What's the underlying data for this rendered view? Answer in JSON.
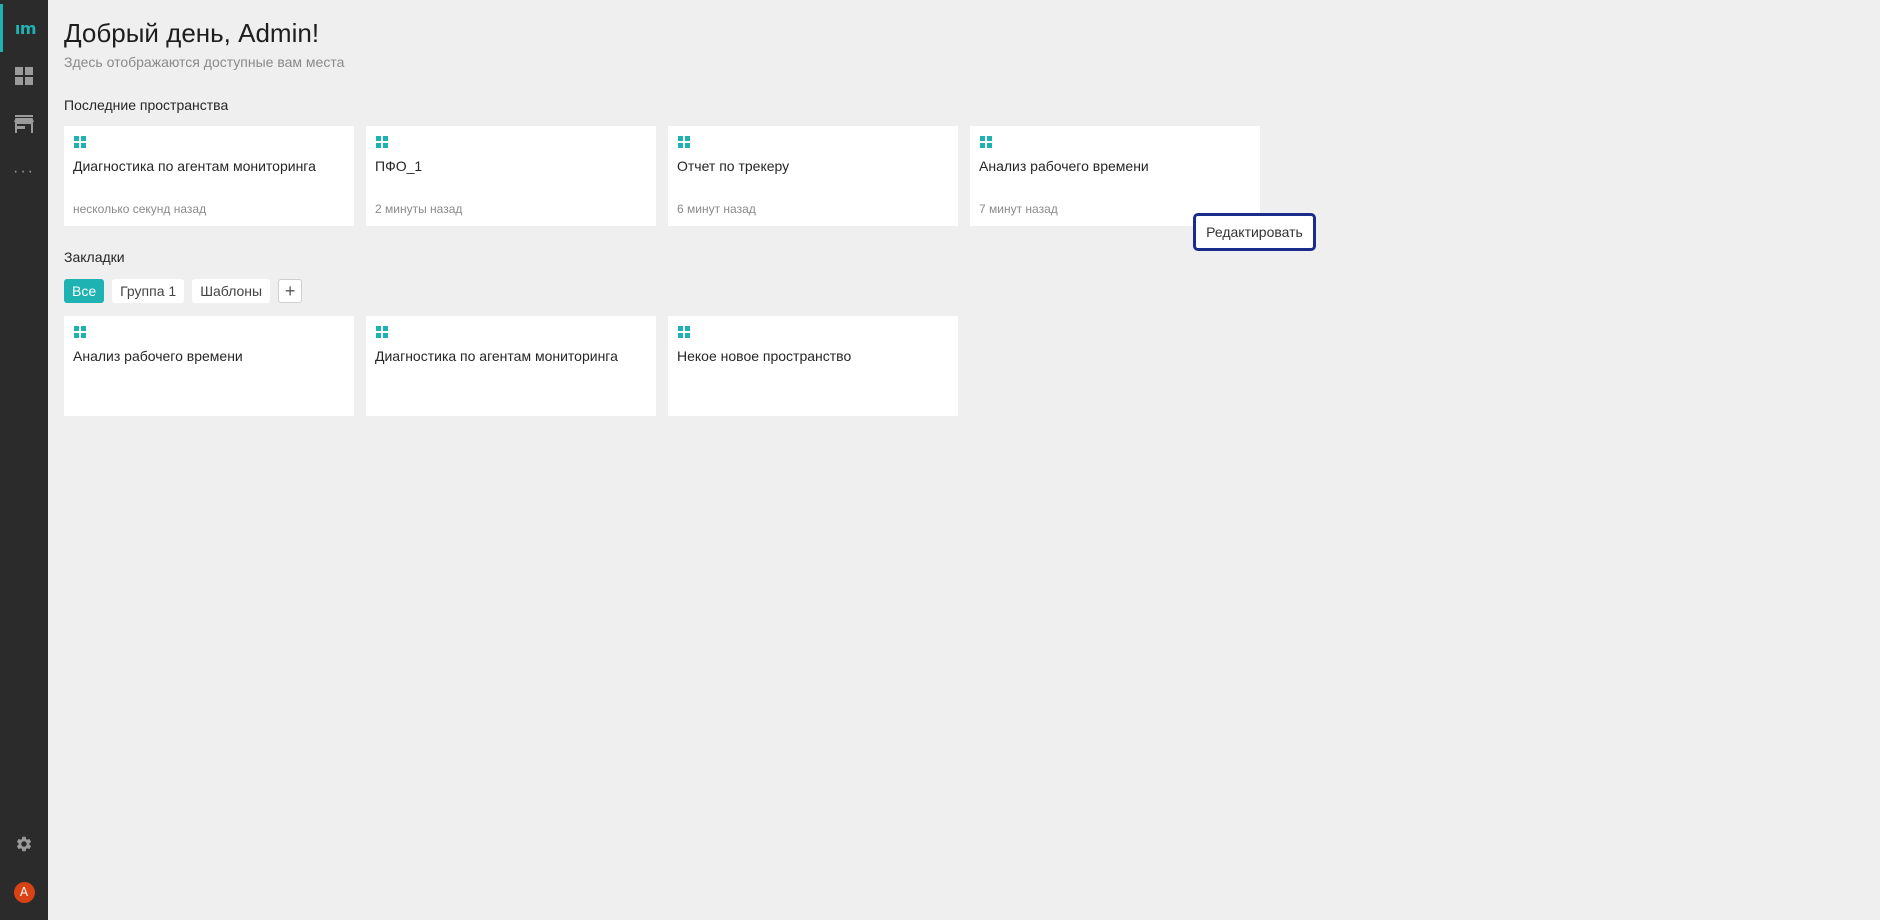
{
  "sidebar": {
    "logo": "ım",
    "items": [
      {
        "icon": "dashboard-grid-icon"
      },
      {
        "icon": "storefront-icon"
      },
      {
        "icon": "more-dots-icon",
        "label": "···"
      }
    ],
    "settings_icon": "gear-icon",
    "avatar_letter": "A"
  },
  "header": {
    "greeting": "Добрый день, Admin!",
    "subtitle": "Здесь отображаются доступные вам места"
  },
  "recent": {
    "title": "Последние пространства",
    "cards": [
      {
        "title": "Диагностика по агентам мониторинга",
        "time": "несколько секунд назад"
      },
      {
        "title": "ПФО_1",
        "time": "2 минуты назад"
      },
      {
        "title": "Отчет по трекеру",
        "time": "6 минут назад"
      },
      {
        "title": "Анализ рабочего времени",
        "time": "7 минут назад"
      }
    ]
  },
  "bookmarks": {
    "title": "Закладки",
    "tabs": [
      "Все",
      "Группа 1",
      "Шаблоны"
    ],
    "add_label": "+",
    "cards": [
      {
        "title": "Анализ рабочего времени"
      },
      {
        "title": "Диагностика по агентам мониторинга"
      },
      {
        "title": "Некое новое пространство"
      }
    ]
  },
  "popup": {
    "edit_label": "Редактировать"
  },
  "colors": {
    "accent": "#1fb2b2",
    "sidebar_bg": "#2b2b2b",
    "page_bg": "#efefef",
    "avatar": "#d84315",
    "focus_border": "#1a2d8c"
  }
}
